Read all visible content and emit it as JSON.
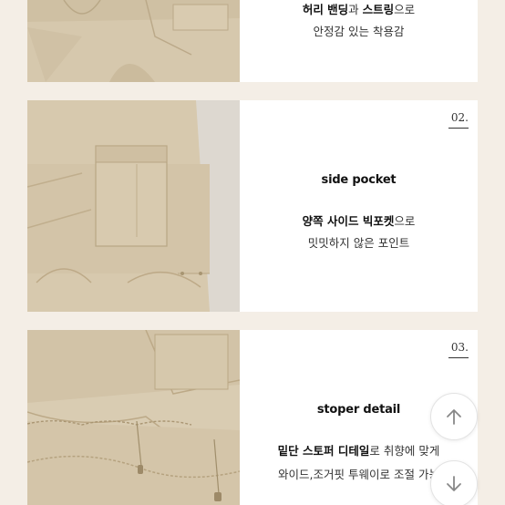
{
  "panel1": {
    "line1_bold_a": "허리 밴딩",
    "line1_mid": "과 ",
    "line1_bold_b": "스트링",
    "line1_tail": "으로",
    "line2": "안정감 있는 착용감"
  },
  "panel2": {
    "number": "02.",
    "heading": "side pocket",
    "line1_bold": "양쪽 사이드 빅포켓",
    "line1_tail": "으로",
    "line2": "밋밋하지 않은 포인트"
  },
  "panel3": {
    "number": "03.",
    "heading": "stoper detail",
    "line1_bold": "밑단 스토퍼 디테일",
    "line1_tail": "로 취향에 맞게",
    "line2": "와이드,조거핏 투웨이로 조절 가능"
  },
  "buttons": {
    "up_icon": "arrow-up-icon",
    "down_icon": "arrow-down-icon"
  },
  "colors": {
    "background": "#f4eee6",
    "fabric": "#d8cbb1"
  }
}
